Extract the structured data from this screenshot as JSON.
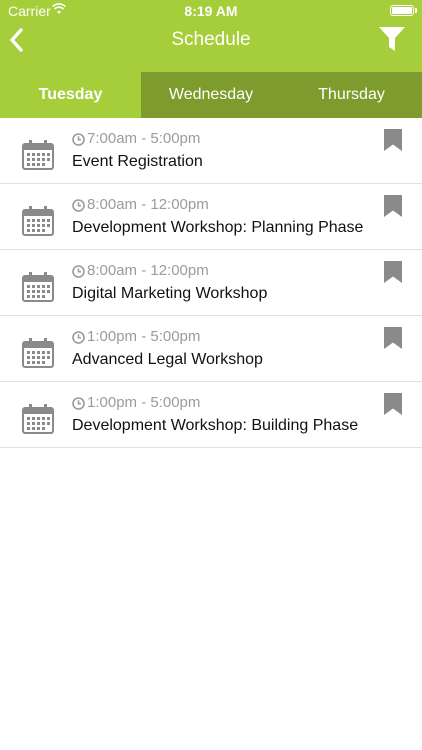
{
  "status_bar": {
    "carrier": "Carrier",
    "time": "8:19 AM"
  },
  "header": {
    "title": "Schedule",
    "back_icon": "chevron-left-icon",
    "filter_icon": "funnel-filter-icon"
  },
  "tabs": [
    {
      "label": "Tuesday",
      "active": true
    },
    {
      "label": "Wednesday",
      "active": false
    },
    {
      "label": "Thursday",
      "active": false
    }
  ],
  "events": [
    {
      "time": "7:00am - 5:00pm",
      "title": "Event Registration"
    },
    {
      "time": "8:00am - 12:00pm",
      "title": "Development Workshop: Planning Phase"
    },
    {
      "time": "8:00am - 12:00pm",
      "title": "Digital Marketing Workshop"
    },
    {
      "time": "1:00pm - 5:00pm",
      "title": "Advanced Legal Workshop"
    },
    {
      "time": "1:00pm - 5:00pm",
      "title": "Development Workshop: Building Phase"
    }
  ],
  "colors": {
    "header_green": "#a6ce3a",
    "tab_inactive": "#7d9c2d",
    "muted_gray": "#9b9b9b"
  }
}
